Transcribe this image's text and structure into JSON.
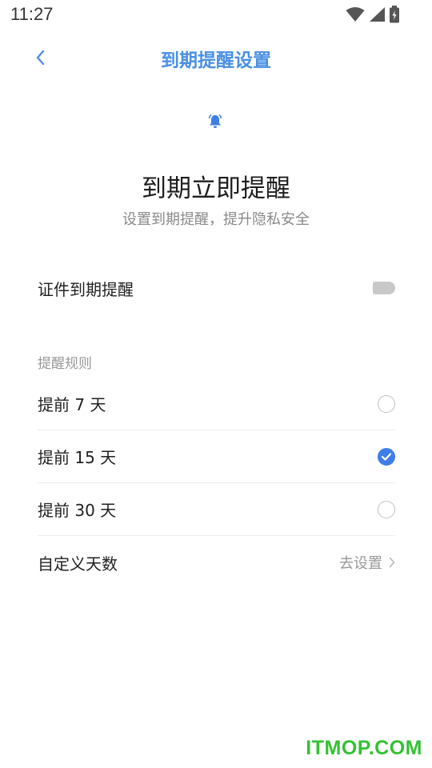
{
  "status_bar": {
    "time": "11:27",
    "icons": [
      "wifi-icon",
      "signal-icon",
      "battery-icon"
    ]
  },
  "header": {
    "title": "到期提醒设置",
    "back_icon": "chevron-left-icon",
    "accent_color": "#4a90e2"
  },
  "hero": {
    "icon": "bell-icon",
    "title": "到期立即提醒",
    "subtitle": "设置到期提醒，提升隐私安全"
  },
  "expiry_toggle": {
    "label": "证件到期提醒",
    "enabled": false
  },
  "rules": {
    "section_label": "提醒规则",
    "options": [
      {
        "label": "提前 7 天",
        "selected": false
      },
      {
        "label": "提前 15 天",
        "selected": true
      },
      {
        "label": "提前 30 天",
        "selected": false
      }
    ],
    "custom": {
      "label": "自定义天数",
      "action": "去设置"
    }
  },
  "watermark": "ITMOP.COM",
  "colors": {
    "check_blue": "#3f7ee6",
    "watermark_green": "#33c233"
  }
}
